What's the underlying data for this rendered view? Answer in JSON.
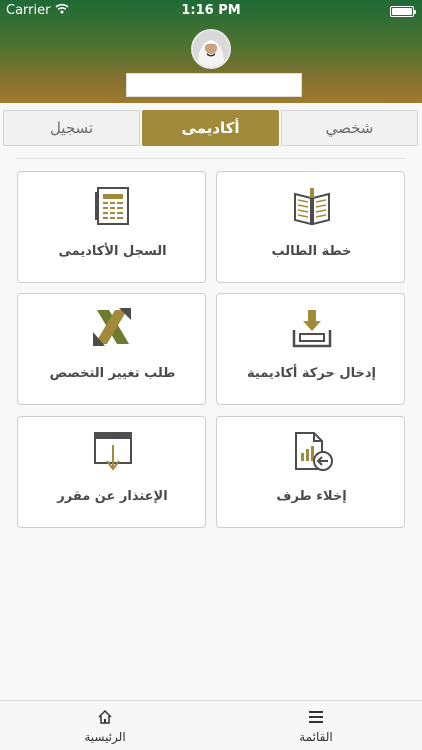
{
  "status_bar": {
    "carrier": "Carrier",
    "time": "1:16 PM"
  },
  "tabs": [
    {
      "label": "تسجيل",
      "active": false
    },
    {
      "label": "أكاديمى",
      "active": true
    },
    {
      "label": "شخصي",
      "active": false
    }
  ],
  "cards": [
    {
      "label": "السجل الأكاديمى",
      "icon": "academic-record-icon"
    },
    {
      "label": "خطة الطالب",
      "icon": "open-book-icon"
    },
    {
      "label": "طلب تغيير التخصص",
      "icon": "swap-arrows-icon"
    },
    {
      "label": "إدخال حركة أكاديمية",
      "icon": "inbox-tray-icon"
    },
    {
      "label": "الإعتذار عن مقرر",
      "icon": "withdraw-box-icon"
    },
    {
      "label": "إخلاء طرف",
      "icon": "document-back-icon"
    }
  ],
  "bottom_nav": {
    "home_label": "الرئيسية",
    "menu_label": "القائمة"
  },
  "colors": {
    "accent": "#a28a3b",
    "header_top": "#1e6a36",
    "header_bottom": "#a07a2e",
    "icon_dark": "#4d4d4d"
  }
}
